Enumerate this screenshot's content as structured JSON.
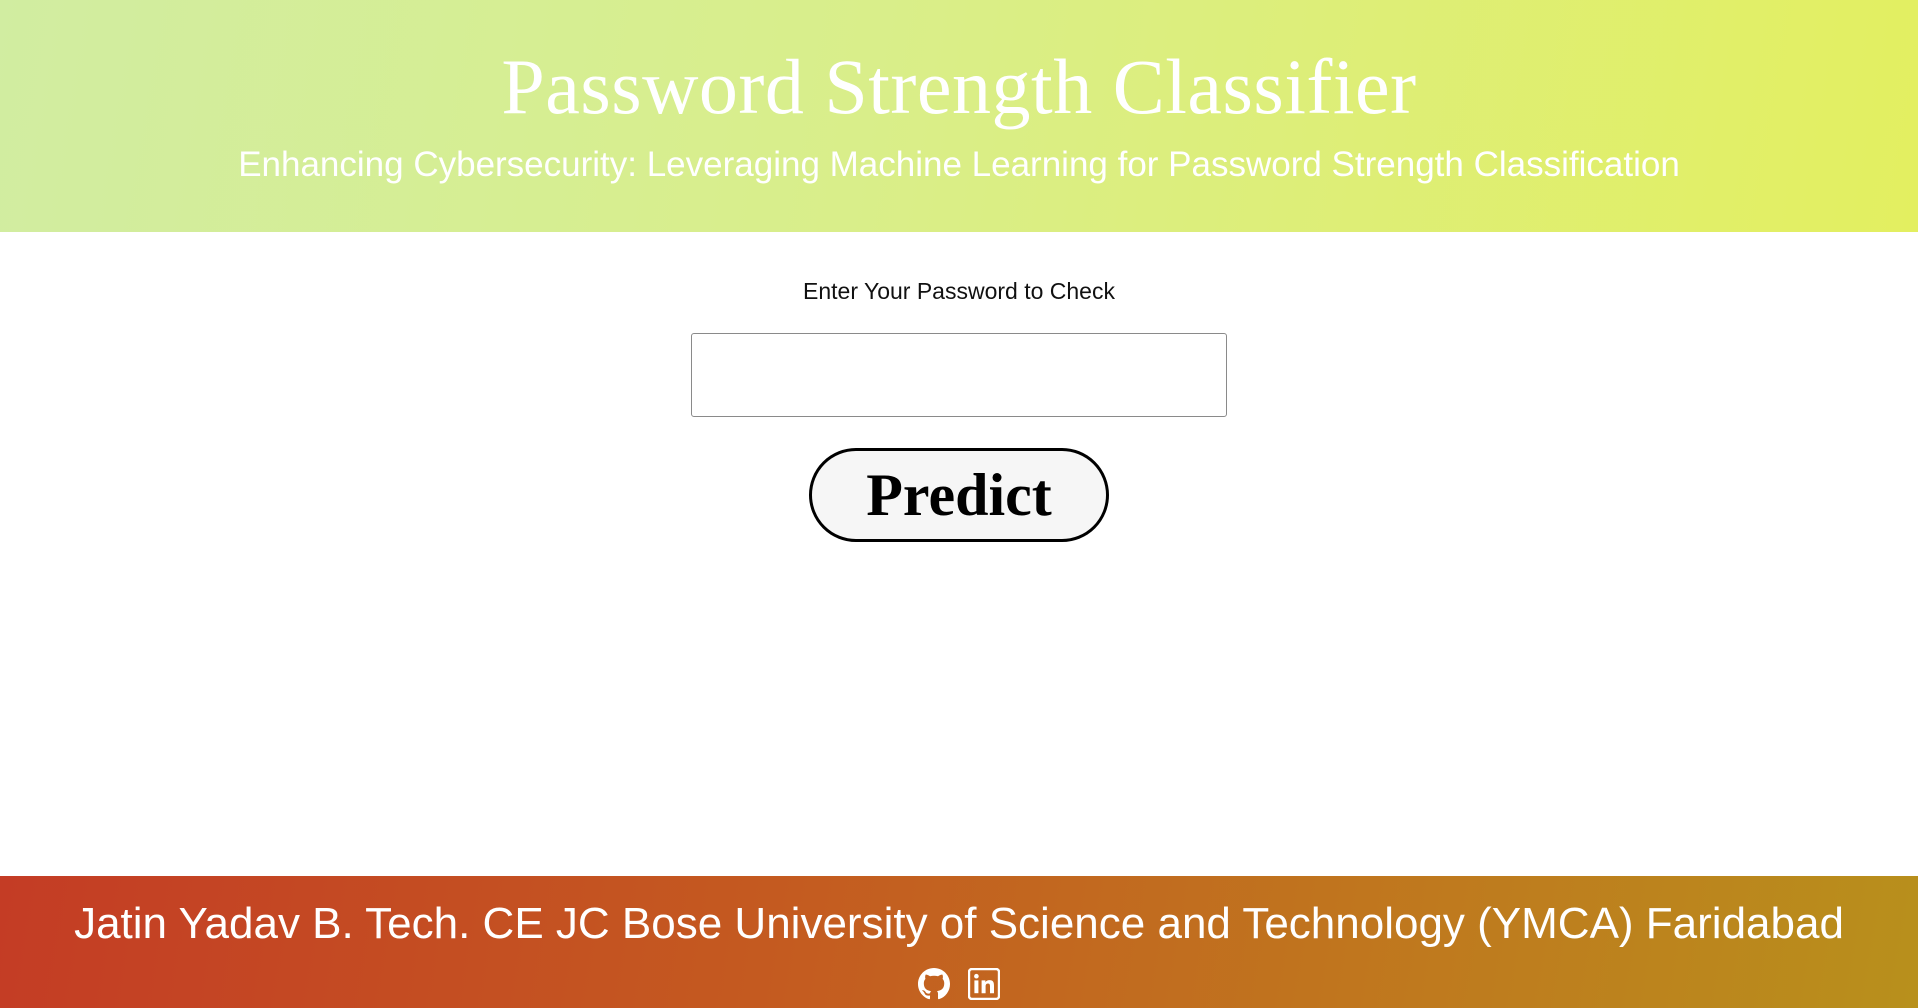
{
  "header": {
    "title": "Password Strength Classifier",
    "subtitle": "Enhancing Cybersecurity: Leveraging Machine Learning for Password Strength Classification"
  },
  "form": {
    "prompt": "Enter Your Password to Check",
    "password_value": "",
    "predict_label": "Predict"
  },
  "footer": {
    "credit": "Jatin Yadav B. Tech. CE JC Bose University of Science and Technology (YMCA) Faridabad",
    "icons": [
      "github-icon",
      "linkedin-icon"
    ]
  },
  "colors": {
    "header_gradient_start": "#d1eda1",
    "header_gradient_end": "#e3ef60",
    "footer_gradient_start": "#c43c25",
    "footer_gradient_end": "#b8901c",
    "text_light": "#ffffff"
  }
}
